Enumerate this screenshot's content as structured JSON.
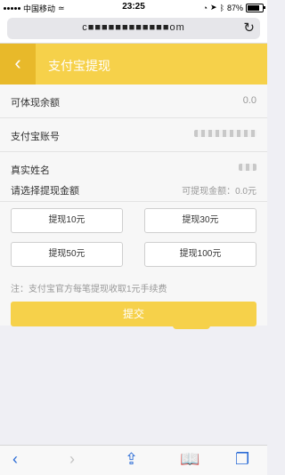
{
  "status": {
    "carrier": "中国移动",
    "time": "23:25",
    "battery": "87%"
  },
  "browser": {
    "url": "c■■■■■■■■■■■■om"
  },
  "header": {
    "title": "支付宝提现"
  },
  "info": {
    "balance_label": "可体现余额",
    "balance_value": "0.0",
    "account_label": "支付宝账号",
    "name_label": "真实姓名"
  },
  "amount": {
    "title": "请选择提现金额",
    "available": "可提现金额：0.0元",
    "options": [
      "提现10元",
      "提现30元",
      "提现50元",
      "提现100元"
    ],
    "note": "注：支付宝官方每笔提现收取1元手续费"
  },
  "submit_label": "提交"
}
